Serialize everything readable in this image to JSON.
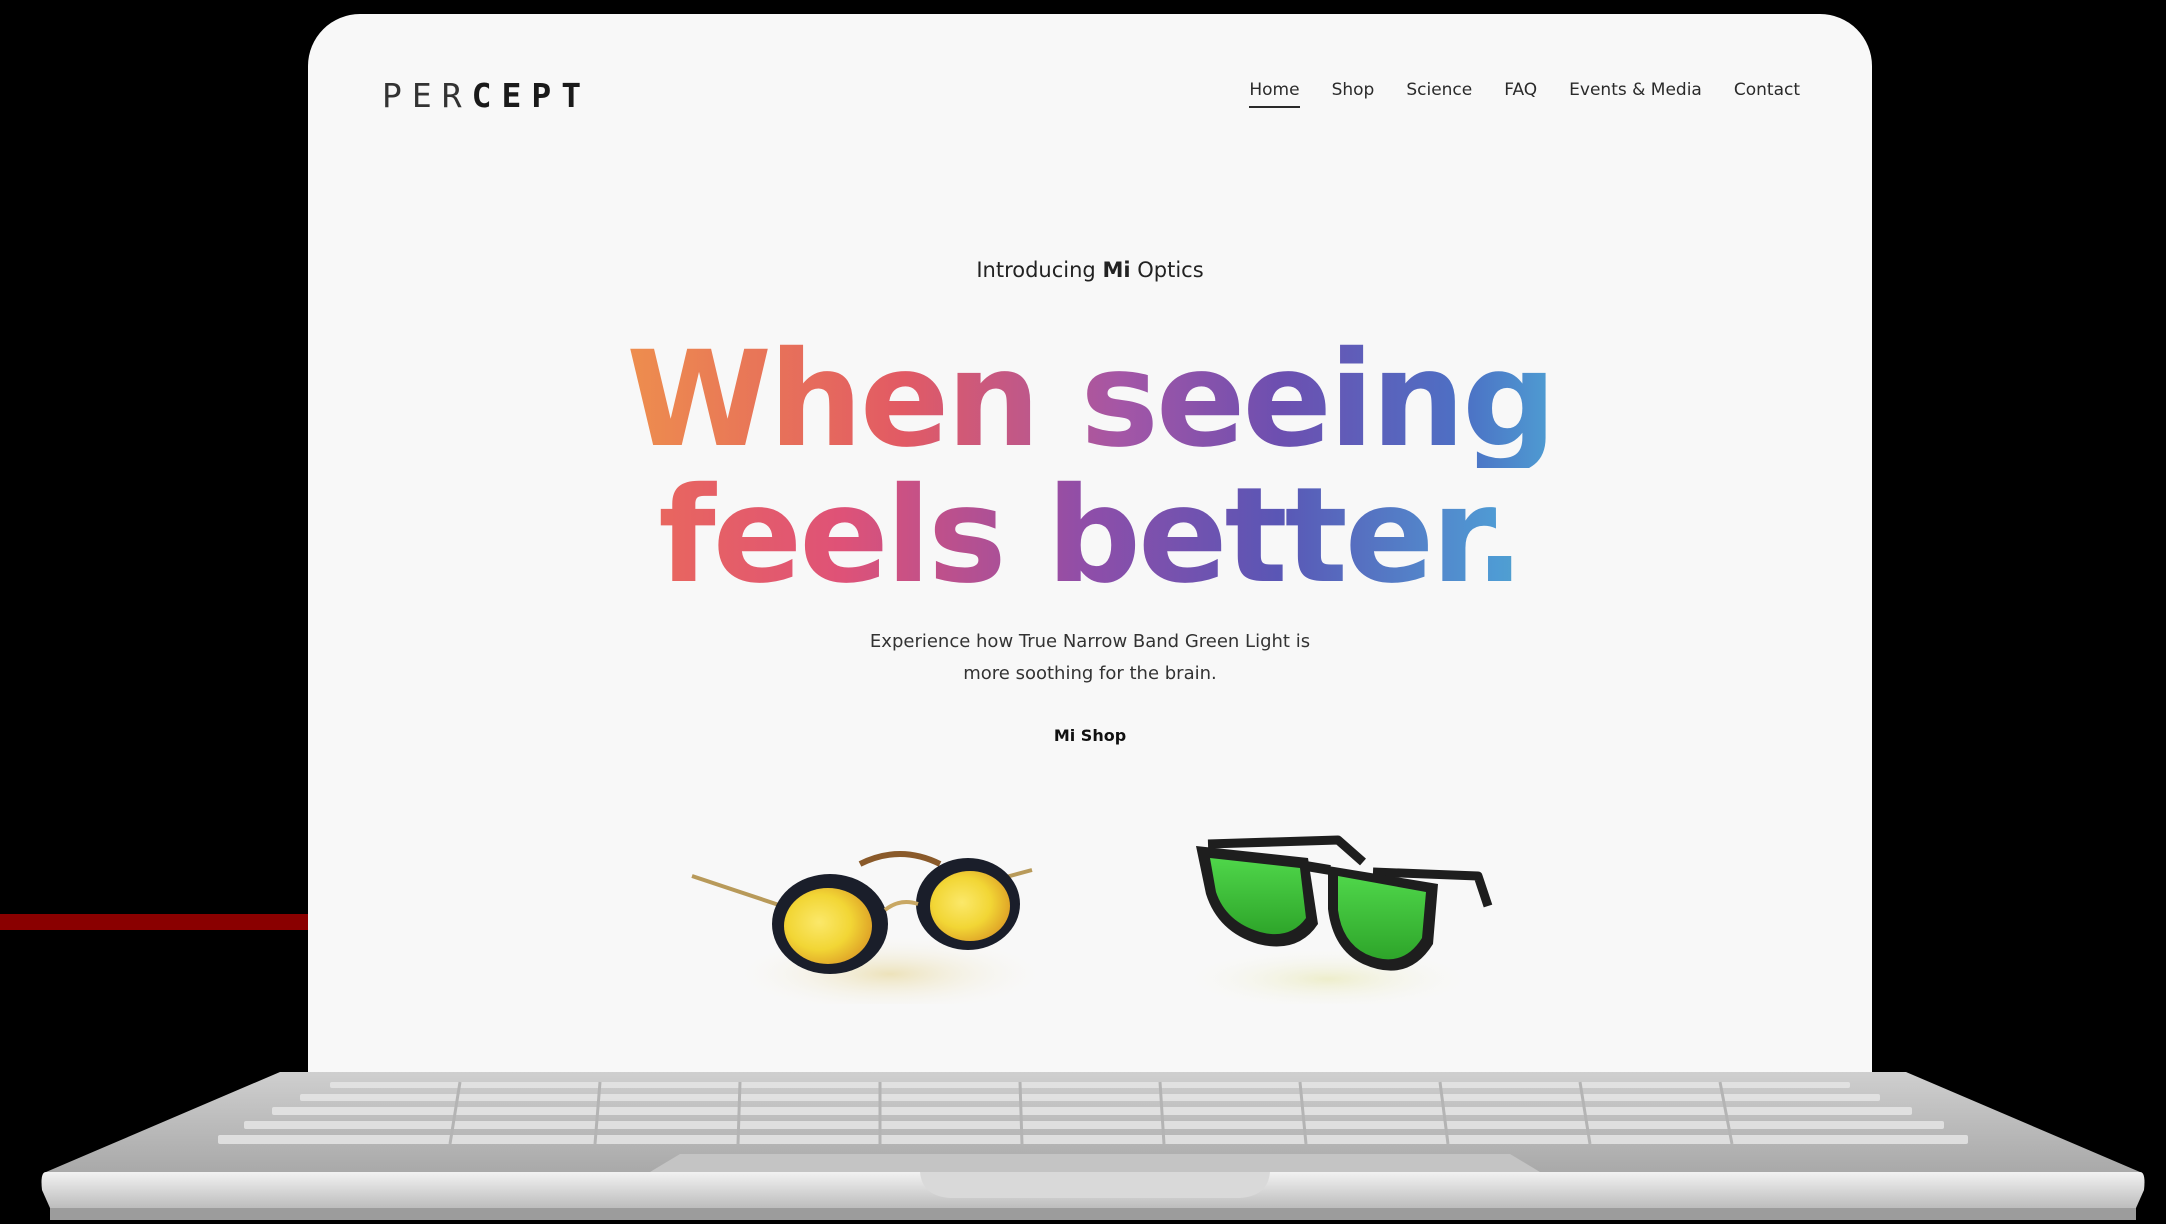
{
  "site": {
    "logo_light": "PER",
    "logo_bold": "CEPT"
  },
  "nav": {
    "items": [
      {
        "label": "Home",
        "active": true
      },
      {
        "label": "Shop",
        "active": false
      },
      {
        "label": "Science",
        "active": false
      },
      {
        "label": "FAQ",
        "active": false
      },
      {
        "label": "Events & Media",
        "active": false
      },
      {
        "label": "Contact",
        "active": false
      }
    ]
  },
  "hero": {
    "intro_prefix": "Introducing",
    "intro_bold": "Mi",
    "intro_suffix": "Optics",
    "headline_line1": "When seeing",
    "headline_line2": "feels better.",
    "subtext_line1": "Experience how True Narrow Band Green Light is",
    "subtext_line2": "more soothing for the brain.",
    "cta_label": "Mi Shop"
  },
  "products": [
    {
      "name": "round-yellow-lens-glasses",
      "lens_color": "#f2d635"
    },
    {
      "name": "green-lens-wayfarer-sunglasses",
      "lens_color": "#3fbf3a"
    }
  ],
  "colors": {
    "page_background": "#000000",
    "screen_background": "#f8f8f8",
    "accent_red_bar": "#8a0000"
  }
}
